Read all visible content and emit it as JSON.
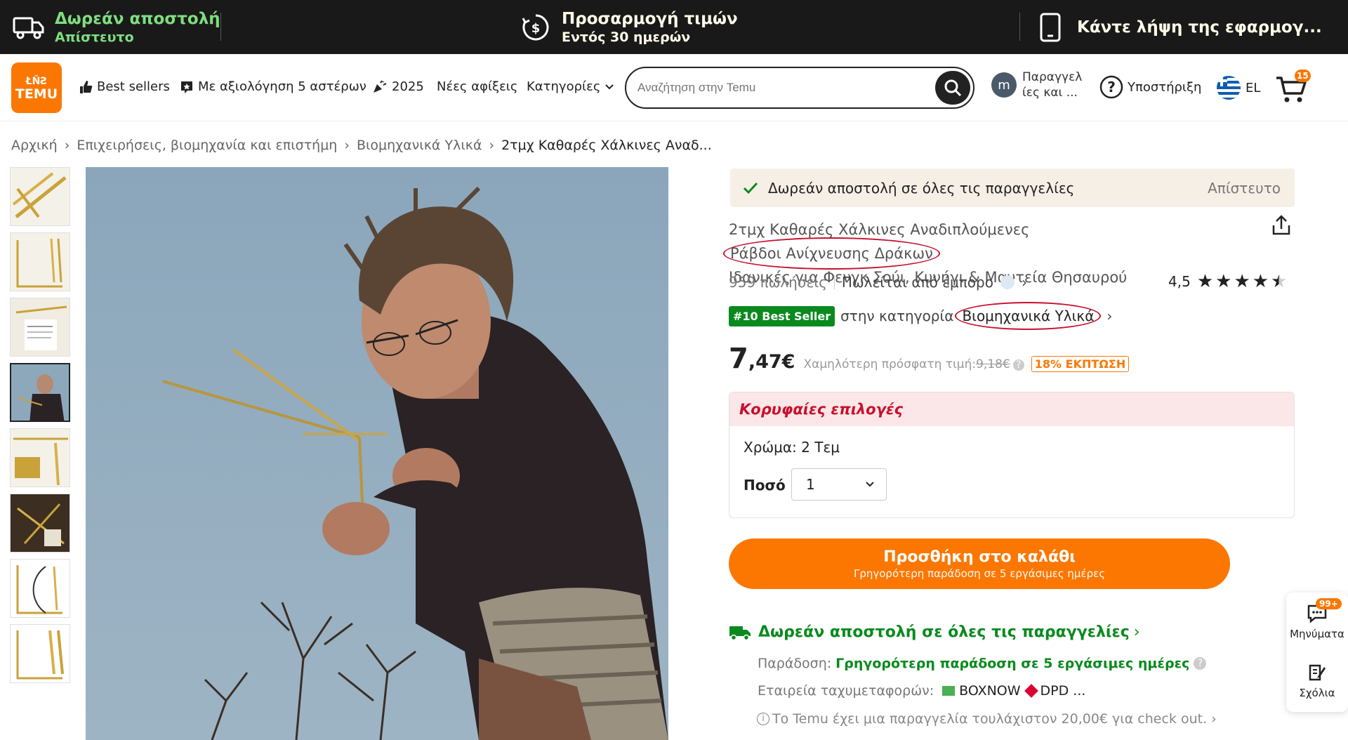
{
  "topbar": {
    "shipping_title": "Δωρεάν αποστολή",
    "shipping_sub": "Απίστευτο",
    "price_title": "Προσαρμογή τιμών",
    "price_sub": "Εντός 30 ημερών",
    "app_text": "Κάντε λήψη της εφαρμογ..."
  },
  "header": {
    "logo_top": "ŁŇƧ",
    "logo_text": "TEMU",
    "nav": [
      "Best sellers",
      "Με αξιολόγηση 5 αστέρων",
      "2025",
      "Νέες αφίξεις",
      "Κατηγορίες"
    ],
    "search_placeholder": "Αναζήτηση στην Temu",
    "account_initial": "m",
    "orders_label": "Παραγγελ ίες και ...",
    "support_label": "Υποστήριξη",
    "lang": "EL",
    "cart_count": "15"
  },
  "breadcrumb": [
    "Αρχική",
    "Επιχειρήσεις, βιομηχανία και επιστήμη",
    "Βιομηχανικά Υλικά",
    "2τμχ Καθαρές Χάλκινες Αναδ..."
  ],
  "product": {
    "free_shipping_banner": "Δωρεάν αποστολή σε όλες τις παραγγελίες",
    "free_shipping_tag": "Απίστευτο",
    "title_part1": "2τμχ Καθαρές Χάλκινες Αναδιπλούμενες ",
    "title_highlight": "Ράβδοι Ανίχνευσης Δράκων",
    "title_line2": "Ιδανικές για Φενγκ Σούι, Κυνήγι & Μαντεία Θησαυρού",
    "sales": "959 πωλήσεις",
    "sold_by": "Πωλείται από έμπορο",
    "rating": "4,5",
    "rating_value": 4.5,
    "best_seller_badge": "#10 Best Seller",
    "category_prefix": "στην κατηγορία ",
    "category": "Βιομηχανικά Υλικά",
    "price_int": "7",
    "price_dec": ",47€",
    "price_note": "Χαμηλότερη πρόσφατη τιμή:",
    "old_price": "9,18€",
    "discount": "18% ΕΚΠΤΩΣΗ",
    "top_choices": "Κορυφαίες επιλογές",
    "color_label": "Χρώμα: 2 Τεμ",
    "qty_label": "Ποσό",
    "qty_value": "1",
    "add_to_cart": "Προσθήκη στο καλάθι",
    "add_to_cart_sub": "Γρηγορότερη παράδοση σε 5 εργάσιμες ημέρες",
    "ship_link": "Δωρεάν αποστολή σε όλες τις παραγγελίες",
    "delivery_label": "Παράδοση:",
    "delivery_value": "Γρηγορότερη παράδοση σε 5 εργάσιμες ημέρες",
    "courier_label": "Εταιρεία ταχυμεταφορών:",
    "courier1": "BOXNOW",
    "courier2": "DPD ...",
    "checkout_note": "Το Temu έχει μια παραγγελία τουλάχιστον 20,00€ για check out."
  },
  "float": {
    "messages_badge": "99+",
    "messages": "Μηνύματα",
    "comments": "Σχόλια"
  },
  "colors": {
    "orange": "#fb7701",
    "green": "#0a8a1e",
    "topbar_green": "#7ede7e",
    "red": "#c8102e"
  }
}
